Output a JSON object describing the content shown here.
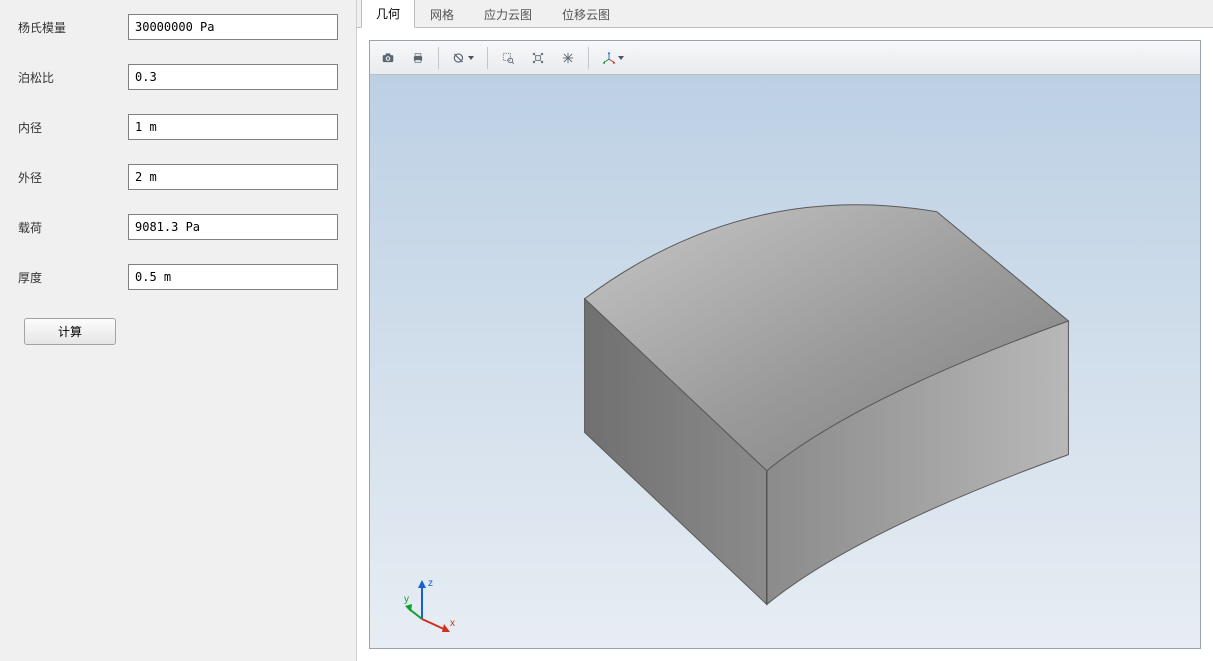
{
  "form": {
    "fields": [
      {
        "label": "杨氏模量",
        "value": "30000000 Pa"
      },
      {
        "label": "泊松比",
        "value": "0.3"
      },
      {
        "label": "内径",
        "value": "1 m"
      },
      {
        "label": "外径",
        "value": "2 m"
      },
      {
        "label": "载荷",
        "value": "9081.3 Pa"
      },
      {
        "label": "厚度",
        "value": "0.5 m"
      }
    ],
    "compute_label": "计算"
  },
  "tabs": {
    "items": [
      {
        "label": "几何",
        "active": true
      },
      {
        "label": "网格",
        "active": false
      },
      {
        "label": "应力云图",
        "active": false
      },
      {
        "label": "位移云图",
        "active": false
      }
    ]
  },
  "toolbar": {
    "icons": [
      "camera-icon",
      "print-icon",
      "SEP",
      "reset-view-icon",
      "SEP",
      "zoom-window-icon",
      "zoom-extents-icon",
      "zoom-selection-icon",
      "SEP",
      "axis-orientation-icon"
    ]
  },
  "axis": {
    "x": "x",
    "y": "y",
    "z": "z"
  },
  "colors": {
    "panel_bg": "#f0f0f0",
    "viewport_top": "#bcd0e4",
    "viewport_bottom": "#e7edf3",
    "solid_light": "#b8b8b8",
    "solid_mid": "#8a8a8a",
    "solid_dark": "#6b6b6b"
  }
}
